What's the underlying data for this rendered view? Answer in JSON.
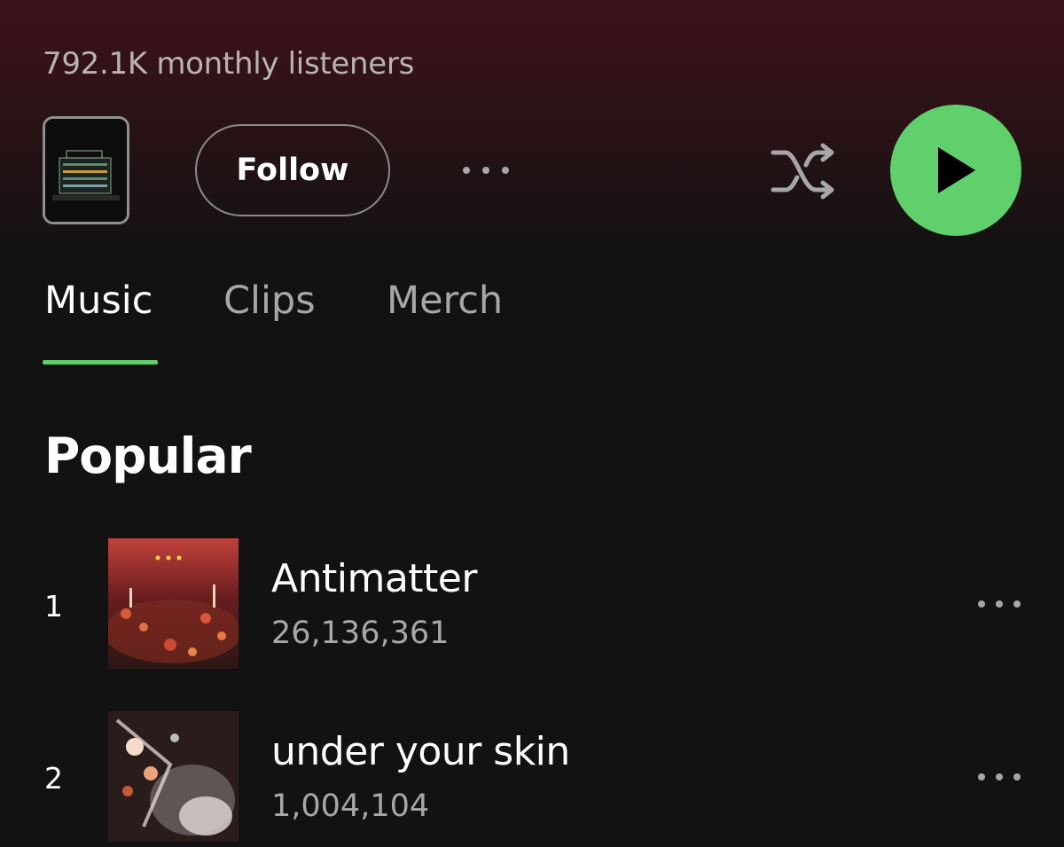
{
  "header": {
    "monthly_listeners": "792.1K monthly listeners",
    "follow_label": "Follow"
  },
  "tabs": [
    {
      "label": "Music",
      "active": true
    },
    {
      "label": "Clips",
      "active": false
    },
    {
      "label": "Merch",
      "active": false
    }
  ],
  "section": {
    "title": "Popular"
  },
  "tracks": [
    {
      "rank": "1",
      "title": "Antimatter",
      "plays": "26,136,361"
    },
    {
      "rank": "2",
      "title": "under your skin",
      "plays": "1,004,104"
    }
  ],
  "colors": {
    "accent": "#5fd06b",
    "background": "#121212",
    "hero_tint": "#3d1219"
  },
  "icons": {
    "more": "more-horizontal-icon",
    "shuffle": "shuffle-icon",
    "play": "play-icon"
  }
}
